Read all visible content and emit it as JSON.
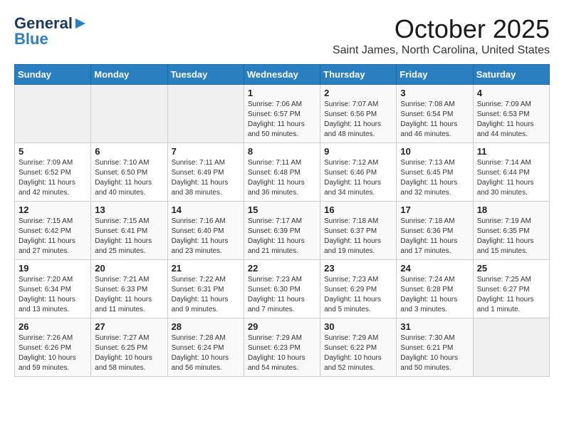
{
  "header": {
    "logo_general": "General",
    "logo_blue": "Blue",
    "month_title": "October 2025",
    "location": "Saint James, North Carolina, United States"
  },
  "weekdays": [
    "Sunday",
    "Monday",
    "Tuesday",
    "Wednesday",
    "Thursday",
    "Friday",
    "Saturday"
  ],
  "weeks": [
    [
      {
        "day": "",
        "sunrise": "",
        "sunset": "",
        "daylight": ""
      },
      {
        "day": "",
        "sunrise": "",
        "sunset": "",
        "daylight": ""
      },
      {
        "day": "",
        "sunrise": "",
        "sunset": "",
        "daylight": ""
      },
      {
        "day": "1",
        "sunrise": "Sunrise: 7:06 AM",
        "sunset": "Sunset: 6:57 PM",
        "daylight": "Daylight: 11 hours and 50 minutes."
      },
      {
        "day": "2",
        "sunrise": "Sunrise: 7:07 AM",
        "sunset": "Sunset: 6:56 PM",
        "daylight": "Daylight: 11 hours and 48 minutes."
      },
      {
        "day": "3",
        "sunrise": "Sunrise: 7:08 AM",
        "sunset": "Sunset: 6:54 PM",
        "daylight": "Daylight: 11 hours and 46 minutes."
      },
      {
        "day": "4",
        "sunrise": "Sunrise: 7:09 AM",
        "sunset": "Sunset: 6:53 PM",
        "daylight": "Daylight: 11 hours and 44 minutes."
      }
    ],
    [
      {
        "day": "5",
        "sunrise": "Sunrise: 7:09 AM",
        "sunset": "Sunset: 6:52 PM",
        "daylight": "Daylight: 11 hours and 42 minutes."
      },
      {
        "day": "6",
        "sunrise": "Sunrise: 7:10 AM",
        "sunset": "Sunset: 6:50 PM",
        "daylight": "Daylight: 11 hours and 40 minutes."
      },
      {
        "day": "7",
        "sunrise": "Sunrise: 7:11 AM",
        "sunset": "Sunset: 6:49 PM",
        "daylight": "Daylight: 11 hours and 38 minutes."
      },
      {
        "day": "8",
        "sunrise": "Sunrise: 7:11 AM",
        "sunset": "Sunset: 6:48 PM",
        "daylight": "Daylight: 11 hours and 36 minutes."
      },
      {
        "day": "9",
        "sunrise": "Sunrise: 7:12 AM",
        "sunset": "Sunset: 6:46 PM",
        "daylight": "Daylight: 11 hours and 34 minutes."
      },
      {
        "day": "10",
        "sunrise": "Sunrise: 7:13 AM",
        "sunset": "Sunset: 6:45 PM",
        "daylight": "Daylight: 11 hours and 32 minutes."
      },
      {
        "day": "11",
        "sunrise": "Sunrise: 7:14 AM",
        "sunset": "Sunset: 6:44 PM",
        "daylight": "Daylight: 11 hours and 30 minutes."
      }
    ],
    [
      {
        "day": "12",
        "sunrise": "Sunrise: 7:15 AM",
        "sunset": "Sunset: 6:42 PM",
        "daylight": "Daylight: 11 hours and 27 minutes."
      },
      {
        "day": "13",
        "sunrise": "Sunrise: 7:15 AM",
        "sunset": "Sunset: 6:41 PM",
        "daylight": "Daylight: 11 hours and 25 minutes."
      },
      {
        "day": "14",
        "sunrise": "Sunrise: 7:16 AM",
        "sunset": "Sunset: 6:40 PM",
        "daylight": "Daylight: 11 hours and 23 minutes."
      },
      {
        "day": "15",
        "sunrise": "Sunrise: 7:17 AM",
        "sunset": "Sunset: 6:39 PM",
        "daylight": "Daylight: 11 hours and 21 minutes."
      },
      {
        "day": "16",
        "sunrise": "Sunrise: 7:18 AM",
        "sunset": "Sunset: 6:37 PM",
        "daylight": "Daylight: 11 hours and 19 minutes."
      },
      {
        "day": "17",
        "sunrise": "Sunrise: 7:18 AM",
        "sunset": "Sunset: 6:36 PM",
        "daylight": "Daylight: 11 hours and 17 minutes."
      },
      {
        "day": "18",
        "sunrise": "Sunrise: 7:19 AM",
        "sunset": "Sunset: 6:35 PM",
        "daylight": "Daylight: 11 hours and 15 minutes."
      }
    ],
    [
      {
        "day": "19",
        "sunrise": "Sunrise: 7:20 AM",
        "sunset": "Sunset: 6:34 PM",
        "daylight": "Daylight: 11 hours and 13 minutes."
      },
      {
        "day": "20",
        "sunrise": "Sunrise: 7:21 AM",
        "sunset": "Sunset: 6:33 PM",
        "daylight": "Daylight: 11 hours and 11 minutes."
      },
      {
        "day": "21",
        "sunrise": "Sunrise: 7:22 AM",
        "sunset": "Sunset: 6:31 PM",
        "daylight": "Daylight: 11 hours and 9 minutes."
      },
      {
        "day": "22",
        "sunrise": "Sunrise: 7:23 AM",
        "sunset": "Sunset: 6:30 PM",
        "daylight": "Daylight: 11 hours and 7 minutes."
      },
      {
        "day": "23",
        "sunrise": "Sunrise: 7:23 AM",
        "sunset": "Sunset: 6:29 PM",
        "daylight": "Daylight: 11 hours and 5 minutes."
      },
      {
        "day": "24",
        "sunrise": "Sunrise: 7:24 AM",
        "sunset": "Sunset: 6:28 PM",
        "daylight": "Daylight: 11 hours and 3 minutes."
      },
      {
        "day": "25",
        "sunrise": "Sunrise: 7:25 AM",
        "sunset": "Sunset: 6:27 PM",
        "daylight": "Daylight: 11 hours and 1 minute."
      }
    ],
    [
      {
        "day": "26",
        "sunrise": "Sunrise: 7:26 AM",
        "sunset": "Sunset: 6:26 PM",
        "daylight": "Daylight: 10 hours and 59 minutes."
      },
      {
        "day": "27",
        "sunrise": "Sunrise: 7:27 AM",
        "sunset": "Sunset: 6:25 PM",
        "daylight": "Daylight: 10 hours and 58 minutes."
      },
      {
        "day": "28",
        "sunrise": "Sunrise: 7:28 AM",
        "sunset": "Sunset: 6:24 PM",
        "daylight": "Daylight: 10 hours and 56 minutes."
      },
      {
        "day": "29",
        "sunrise": "Sunrise: 7:29 AM",
        "sunset": "Sunset: 6:23 PM",
        "daylight": "Daylight: 10 hours and 54 minutes."
      },
      {
        "day": "30",
        "sunrise": "Sunrise: 7:29 AM",
        "sunset": "Sunset: 6:22 PM",
        "daylight": "Daylight: 10 hours and 52 minutes."
      },
      {
        "day": "31",
        "sunrise": "Sunrise: 7:30 AM",
        "sunset": "Sunset: 6:21 PM",
        "daylight": "Daylight: 10 hours and 50 minutes."
      },
      {
        "day": "",
        "sunrise": "",
        "sunset": "",
        "daylight": ""
      }
    ]
  ]
}
